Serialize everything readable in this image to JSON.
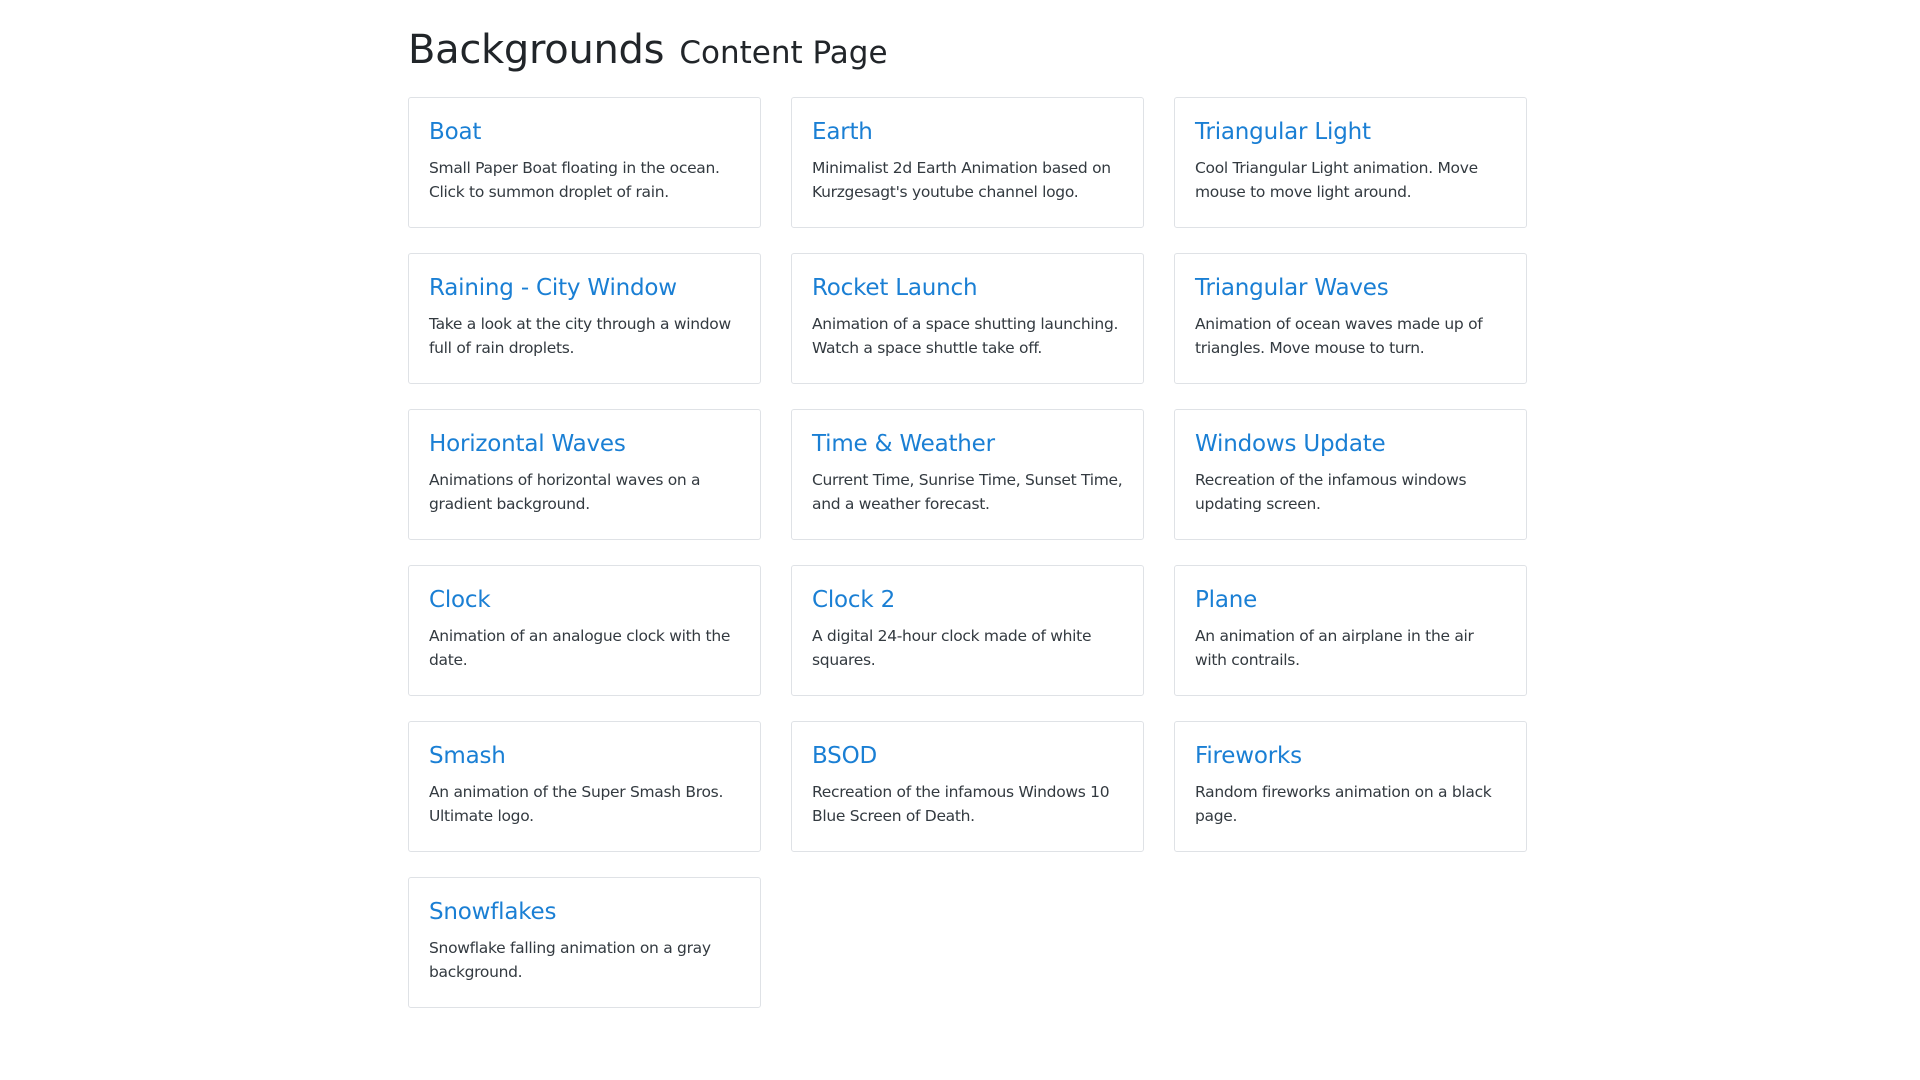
{
  "header": {
    "title": "Backgrounds",
    "subtitle": "Content Page"
  },
  "cards": [
    {
      "title": "Boat",
      "description": "Small Paper Boat floating in the ocean. Click to summon droplet of rain."
    },
    {
      "title": "Earth",
      "description": "Minimalist 2d Earth Animation based on Kurzgesagt's youtube channel logo."
    },
    {
      "title": "Triangular Light",
      "description": "Cool Triangular Light animation. Move mouse to move light around."
    },
    {
      "title": "Raining - City Window",
      "description": "Take a look at the city through a window full of rain droplets."
    },
    {
      "title": "Rocket Launch",
      "description": "Animation of a space shutting launching. Watch a space shuttle take off."
    },
    {
      "title": "Triangular Waves",
      "description": "Animation of ocean waves made up of triangles. Move mouse to turn."
    },
    {
      "title": "Horizontal Waves",
      "description": "Animations of horizontal waves on a gradient background."
    },
    {
      "title": "Time & Weather",
      "description": "Current Time, Sunrise Time, Sunset Time, and a weather forecast."
    },
    {
      "title": "Windows Update",
      "description": "Recreation of the infamous windows updating screen."
    },
    {
      "title": "Clock",
      "description": "Animation of an analogue clock with the date."
    },
    {
      "title": "Clock 2",
      "description": "A digital 24-hour clock made of white squares."
    },
    {
      "title": "Plane",
      "description": "An animation of an airplane in the air with contrails."
    },
    {
      "title": "Smash",
      "description": "An animation of the Super Smash Bros. Ultimate logo."
    },
    {
      "title": "BSOD",
      "description": "Recreation of the infamous Windows 10 Blue Screen of Death."
    },
    {
      "title": "Fireworks",
      "description": "Random fireworks animation on a black page."
    },
    {
      "title": "Snowflakes",
      "description": "Snowflake falling animation on a gray background."
    }
  ],
  "colors": {
    "link": "#1a7fd4",
    "text": "#212529",
    "border": "#dfe2e6"
  }
}
